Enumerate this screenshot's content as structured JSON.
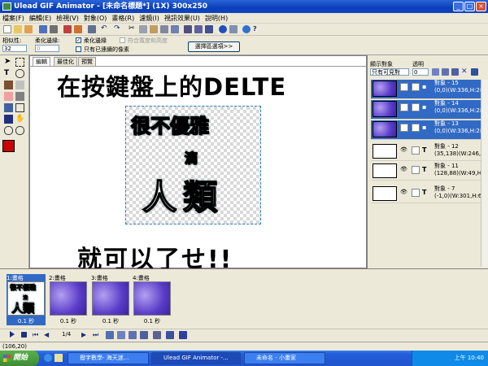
{
  "window": {
    "title": "Ulead GIF Animator - [未命名標題*] (1X) 300x250"
  },
  "menu": [
    "檔案(F)",
    "編輯(E)",
    "檢視(V)",
    "對象(O)",
    "畫格(R)",
    "濾鏡(I)",
    "視訊效果(U)",
    "說明(H)"
  ],
  "options": {
    "similarity_label": "相似性:",
    "similarity_value": "32",
    "soften_label": "柔化邊緣:",
    "soften_value": "0",
    "soften_check": "柔化邊緣",
    "keep_ratio": "符合寬度和高度",
    "connected_only": "只有已連續的像素",
    "select_button": "選擇區選項>>"
  },
  "tabs": [
    "編輯",
    "最佳化",
    "預覽"
  ],
  "canvas_text": {
    "line1": "在按鍵盤上的DELTE",
    "line2": "就可以了せ!!"
  },
  "artwork": {
    "row1": "很不優雅",
    "row2": "滴",
    "row3": "人類"
  },
  "object_panel": {
    "show_label": "顯示對象",
    "transparency_label": "透明",
    "show_value": "只有可見對",
    "transparency_value": "0",
    "objects": [
      {
        "name": "對象 - 15",
        "info": "(0,0)(W:336,H:280)",
        "selected": true
      },
      {
        "name": "對象 - 14",
        "info": "(0,0)(W:336,H:280)",
        "selected": true
      },
      {
        "name": "對象 - 13",
        "info": "(0,0)(W:336,H:280)",
        "selected": true
      },
      {
        "name": "對象 - 12",
        "info": "(35,138)(W:246,H:10",
        "selected": false
      },
      {
        "name": "對象 - 11",
        "info": "(128,88)(W:49,H:47)",
        "selected": false
      },
      {
        "name": "對象 - 7",
        "info": "(-1,0)(W:301,H:67)",
        "selected": false
      }
    ]
  },
  "frames": [
    {
      "title": "1:畫格",
      "delay": "0.1 秒"
    },
    {
      "title": "2:畫格",
      "delay": "0.1 秒"
    },
    {
      "title": "3:畫格",
      "delay": "0.1 秒"
    },
    {
      "title": "4:畫格",
      "delay": "0.1 秒"
    }
  ],
  "frame_counter": "1/4",
  "status": "(106,20)",
  "taskbar": {
    "start": "開始",
    "tasks": [
      "撥字數學- 海天迷...",
      "Ulead GIF Animator -...",
      "未命名 - 小畫家"
    ],
    "clock": "上午 10:40"
  },
  "colors": {
    "accent": "#316ac5",
    "foreground": "#cc0000"
  }
}
